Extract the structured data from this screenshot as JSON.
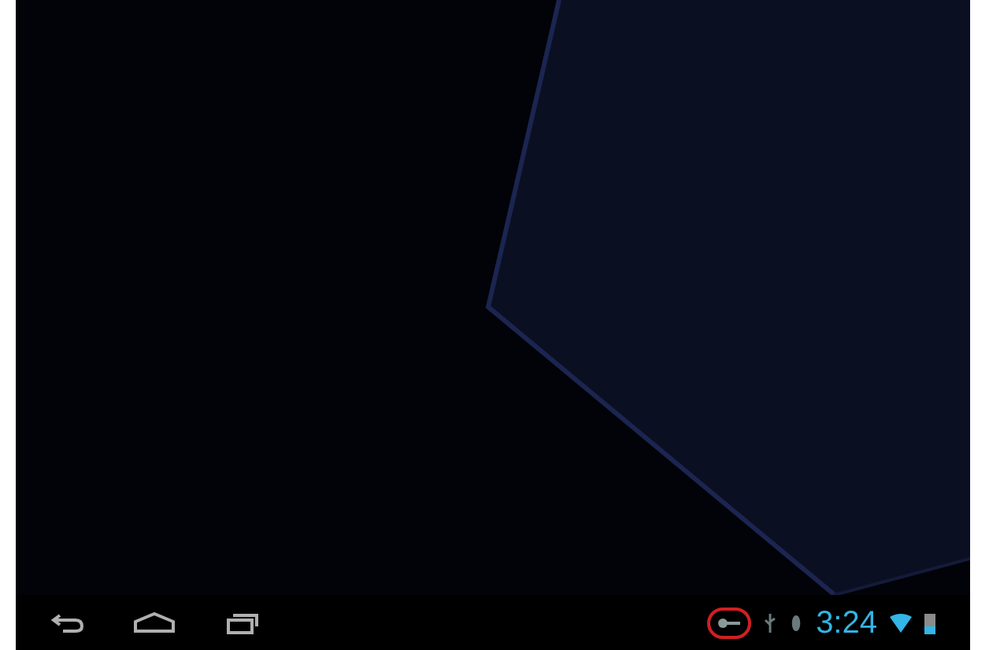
{
  "navigation_bar": {
    "buttons": [
      {
        "kind": "back"
      },
      {
        "kind": "home"
      },
      {
        "kind": "recent"
      }
    ]
  },
  "status_bar": {
    "icons": [
      {
        "kind": "key",
        "highlighted": true
      },
      {
        "kind": "usb",
        "highlighted": false
      },
      {
        "kind": "debug",
        "highlighted": false
      }
    ],
    "time": "3:24"
  }
}
